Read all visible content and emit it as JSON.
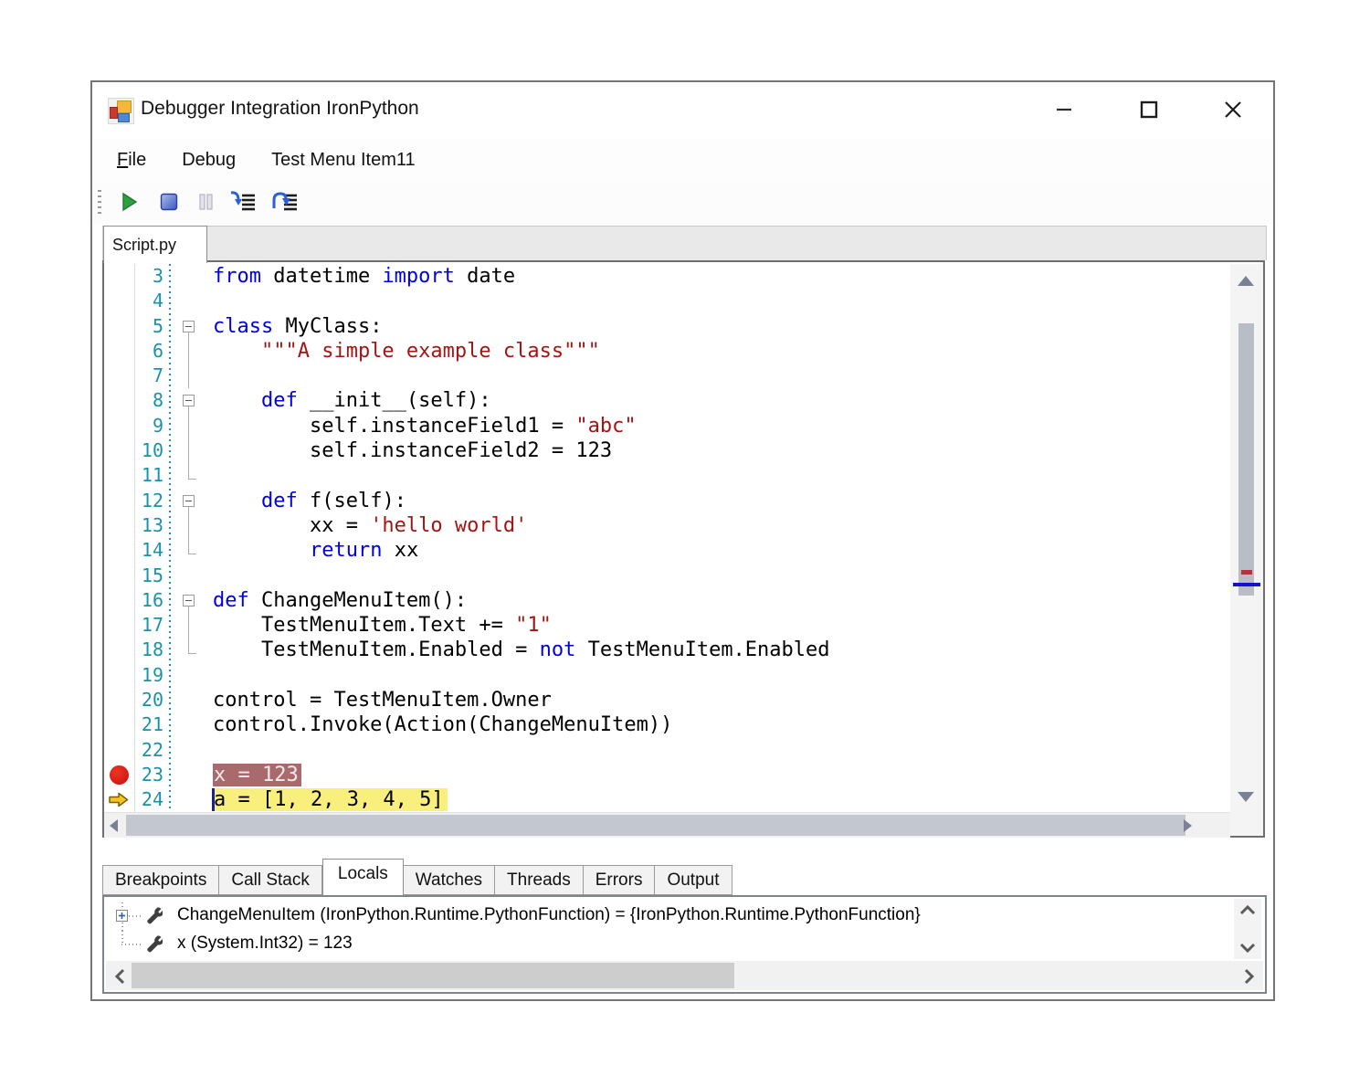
{
  "window": {
    "title": "Debugger Integration IronPython",
    "controls": {
      "minimize": "minimize",
      "maximize": "maximize",
      "close": "close"
    }
  },
  "menu": {
    "items": [
      {
        "label": "File",
        "accel_first_letter": true
      },
      {
        "label": "Debug",
        "accel_first_letter": false
      },
      {
        "label": "Test Menu Item11",
        "accel_first_letter": false
      }
    ]
  },
  "toolbar": {
    "buttons": [
      "run",
      "stop",
      "pause",
      "step-into",
      "step-over"
    ]
  },
  "editor": {
    "tab": "Script.py",
    "breakpoint_line": "23",
    "current_line": "24",
    "colors": {
      "line_number": "#1a92a8",
      "keyword": "#0000e6",
      "string": "#a31515",
      "breakpoint_highlight": "#a96a6e",
      "current_highlight": "#f8ef7c",
      "breakpoint_dot": "#c50f0f",
      "current_arrow": "#f7c325"
    },
    "lines": [
      {
        "n": "3",
        "fold": "",
        "hl": "",
        "segs": [
          [
            "kw",
            "from"
          ],
          [
            "txt",
            " datetime "
          ],
          [
            "kw",
            "import"
          ],
          [
            "txt",
            " date"
          ]
        ]
      },
      {
        "n": "4",
        "fold": "",
        "hl": "",
        "segs": []
      },
      {
        "n": "5",
        "fold": "box",
        "hl": "",
        "segs": [
          [
            "kw",
            "class"
          ],
          [
            "txt",
            " MyClass:"
          ]
        ]
      },
      {
        "n": "6",
        "fold": "line",
        "hl": "",
        "segs": [
          [
            "txt",
            "    "
          ],
          [
            "str",
            "\"\"\"A simple example class\"\"\""
          ]
        ]
      },
      {
        "n": "7",
        "fold": "line",
        "hl": "",
        "segs": []
      },
      {
        "n": "8",
        "fold": "box",
        "hl": "",
        "segs": [
          [
            "txt",
            "    "
          ],
          [
            "kw",
            "def"
          ],
          [
            "txt",
            " __init__(self):"
          ]
        ]
      },
      {
        "n": "9",
        "fold": "line",
        "hl": "",
        "segs": [
          [
            "txt",
            "        self.instanceField1 = "
          ],
          [
            "str",
            "\"abc\""
          ]
        ]
      },
      {
        "n": "10",
        "fold": "line",
        "hl": "",
        "segs": [
          [
            "txt",
            "        self.instanceField2 = 123"
          ]
        ]
      },
      {
        "n": "11",
        "fold": "end",
        "hl": "",
        "segs": []
      },
      {
        "n": "12",
        "fold": "box",
        "hl": "",
        "segs": [
          [
            "txt",
            "    "
          ],
          [
            "kw",
            "def"
          ],
          [
            "txt",
            " f(self):"
          ]
        ]
      },
      {
        "n": "13",
        "fold": "line",
        "hl": "",
        "segs": [
          [
            "txt",
            "        xx = "
          ],
          [
            "str",
            "'hello world'"
          ]
        ]
      },
      {
        "n": "14",
        "fold": "end",
        "hl": "",
        "segs": [
          [
            "txt",
            "        "
          ],
          [
            "kw",
            "return"
          ],
          [
            "txt",
            " xx"
          ]
        ]
      },
      {
        "n": "15",
        "fold": "",
        "hl": "",
        "segs": []
      },
      {
        "n": "16",
        "fold": "box",
        "hl": "",
        "segs": [
          [
            "kw",
            "def"
          ],
          [
            "txt",
            " ChangeMenuItem():"
          ]
        ]
      },
      {
        "n": "17",
        "fold": "line",
        "hl": "",
        "segs": [
          [
            "txt",
            "    TestMenuItem.Text += "
          ],
          [
            "str",
            "\"1\""
          ]
        ]
      },
      {
        "n": "18",
        "fold": "end",
        "hl": "",
        "segs": [
          [
            "txt",
            "    TestMenuItem.Enabled = "
          ],
          [
            "kw",
            "not"
          ],
          [
            "txt",
            " TestMenuItem.Enabled"
          ]
        ]
      },
      {
        "n": "19",
        "fold": "",
        "hl": "",
        "segs": []
      },
      {
        "n": "20",
        "fold": "",
        "hl": "",
        "segs": [
          [
            "txt",
            "control = TestMenuItem.Owner"
          ]
        ]
      },
      {
        "n": "21",
        "fold": "",
        "hl": "",
        "segs": [
          [
            "txt",
            "control.Invoke(Action(ChangeMenuItem))"
          ]
        ]
      },
      {
        "n": "22",
        "fold": "",
        "hl": "",
        "segs": []
      },
      {
        "n": "23",
        "fold": "",
        "hl": "breakpoint",
        "segs": [
          [
            "txt",
            "x = 123"
          ]
        ]
      },
      {
        "n": "24",
        "fold": "",
        "hl": "current",
        "segs": [
          [
            "txt",
            "a = [1, 2, 3, 4, 5]"
          ]
        ]
      }
    ]
  },
  "bottom": {
    "tabs": [
      "Breakpoints",
      "Call Stack",
      "Locals",
      "Watches",
      "Threads",
      "Errors",
      "Output"
    ],
    "active": "Locals"
  },
  "locals": {
    "items": [
      {
        "expandable": true,
        "label": "ChangeMenuItem (IronPython.Runtime.PythonFunction) = {IronPython.Runtime.PythonFunction}"
      },
      {
        "expandable": false,
        "label": "x (System.Int32) = 123"
      }
    ]
  }
}
